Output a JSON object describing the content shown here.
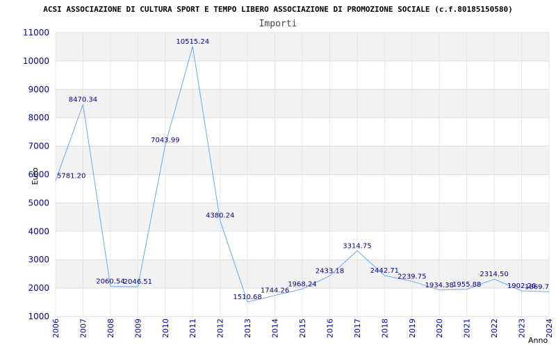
{
  "chart_data": {
    "type": "line",
    "title": "ACSI ASSOCIAZIONE DI CULTURA SPORT E TEMPO LIBERO ASSOCIAZIONE DI PROMOZIONE SOCIALE (c.f.80185150580)",
    "subtitle": "Importi",
    "xlabel": "Anno",
    "ylabel": "Euro",
    "x": [
      "2006",
      "2007",
      "2008",
      "2009",
      "2010",
      "2011",
      "2012",
      "2013",
      "2014",
      "2015",
      "2016",
      "2017",
      "2018",
      "2019",
      "2020",
      "2021",
      "2022",
      "2023",
      "2024"
    ],
    "values": [
      5781.2,
      8470.34,
      2060.54,
      2046.51,
      7043.99,
      10515.24,
      4380.24,
      1510.68,
      1744.26,
      1968.24,
      2433.18,
      3314.75,
      2442.71,
      2239.75,
      1934.38,
      1955.88,
      2314.5,
      1902.26,
      1869.7
    ],
    "labels": [
      "5781.20",
      "8470.34",
      "2060.54",
      "2046.51",
      "7043.99",
      "10515.24",
      "4380.24",
      "1510.68",
      "1744.26",
      "1968.24",
      "2433.18",
      "3314.75",
      "2442.71",
      "2239.75",
      "1934.38",
      "1955.88",
      "2314.50",
      "1902.26",
      "1869.7"
    ],
    "ylim": [
      1000,
      11000
    ],
    "yticks": [
      "1000",
      "2000",
      "3000",
      "4000",
      "5000",
      "6000",
      "7000",
      "8000",
      "9000",
      "10000",
      "11000"
    ],
    "grid": true,
    "colors": {
      "line": "#66aaee",
      "band": "#f2f2f2",
      "tick_text": "#0000aa",
      "label_text": "#000088"
    }
  }
}
